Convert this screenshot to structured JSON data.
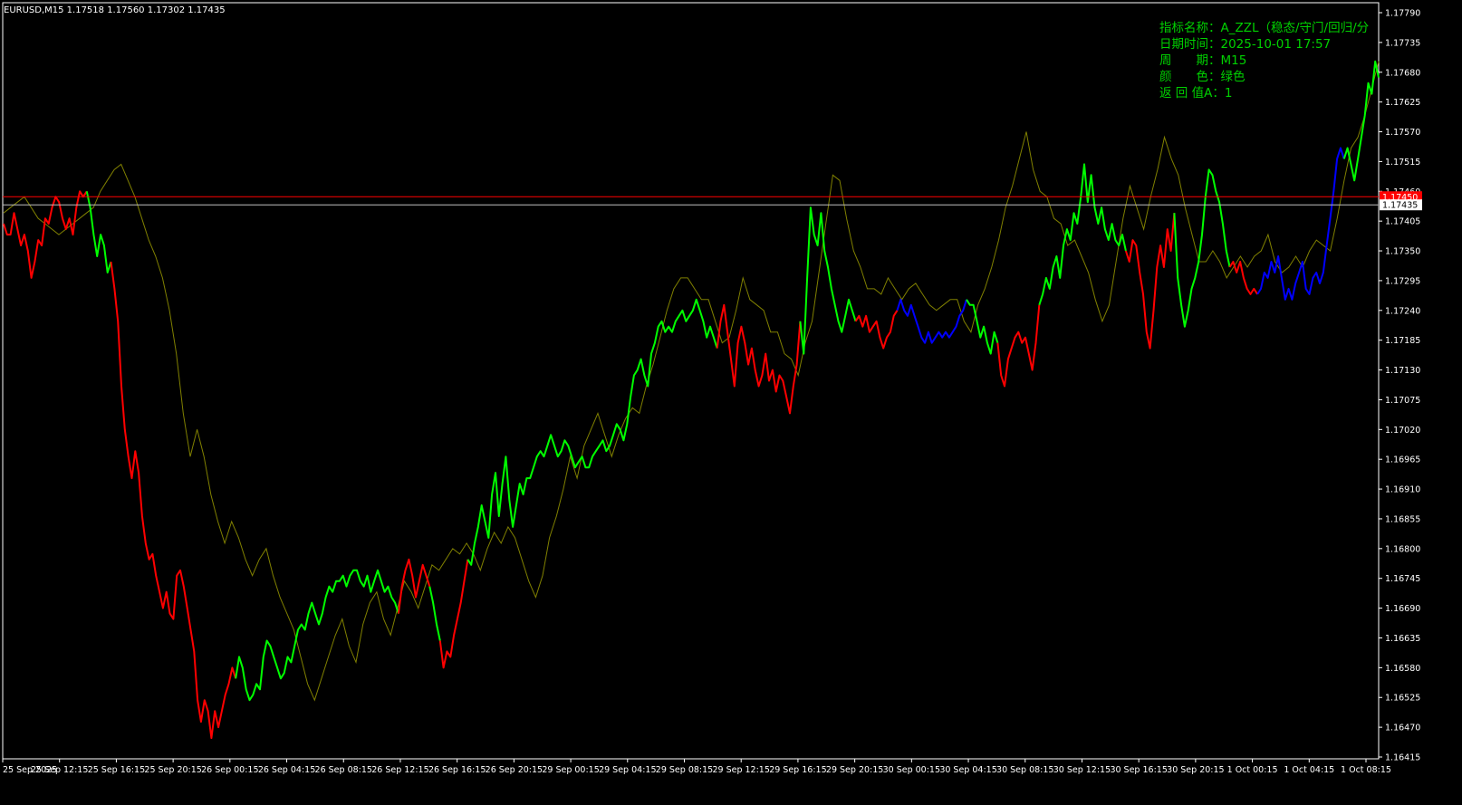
{
  "header": {
    "symbol_line": "EURUSD,M15  1.17518 1.17560 1.17302 1.17435"
  },
  "info_panel": {
    "lines": [
      "指标名称：A_ZZL（稳态/守门/回归/分",
      "日期时间：2025-10-01 17:57",
      "周　　期：M15",
      "颜　　色：绿色",
      "返 回 值A：1"
    ],
    "color": "#00D000"
  },
  "colors": {
    "background": "#000000",
    "axis": "#FFFFFF",
    "green": "#00FF00",
    "red": "#FF0000",
    "blue": "#0000FF",
    "price_line": "#808000",
    "bid_line": "#C0C0C0",
    "ask_line": "#FF0000"
  },
  "price_labels": {
    "bid": "1.17435",
    "ask": "1.17450"
  },
  "chart_data": {
    "type": "line",
    "ylim": [
      1.16415,
      1.1779
    ],
    "yticks": [
      "1.17790",
      "1.17735",
      "1.17680",
      "1.17625",
      "1.17570",
      "1.17515",
      "1.17460",
      "1.17405",
      "1.17350",
      "1.17295",
      "1.17240",
      "1.17185",
      "1.17130",
      "1.17075",
      "1.17020",
      "1.16965",
      "1.16910",
      "1.16855",
      "1.16800",
      "1.16745",
      "1.16690",
      "1.16635",
      "1.16580",
      "1.16525",
      "1.16470",
      "1.16415"
    ],
    "xticks": [
      "25 Sep 2025",
      "25 Sep 12:15",
      "25 Sep 16:15",
      "25 Sep 20:15",
      "26 Sep 00:15",
      "26 Sep 04:15",
      "26 Sep 08:15",
      "26 Sep 12:15",
      "26 Sep 16:15",
      "26 Sep 20:15",
      "29 Sep 00:15",
      "29 Sep 04:15",
      "29 Sep 08:15",
      "29 Sep 12:15",
      "29 Sep 16:15",
      "29 Sep 20:15",
      "30 Sep 00:15",
      "30 Sep 04:15",
      "30 Sep 08:15",
      "30 Sep 12:15",
      "30 Sep 16:15",
      "30 Sep 20:15",
      "1 Oct 00:15",
      "1 Oct 04:15",
      "1 Oct 08:15"
    ],
    "bid_price": 1.17435,
    "ask_price": 1.1745,
    "series": [
      {
        "segments": [
          {
            "color": "red",
            "values": [
              1.174,
              1.1738,
              1.1738,
              1.1742,
              1.1739,
              1.1736,
              1.1738,
              1.1735,
              1.173,
              1.1733,
              1.1737,
              1.1736,
              1.1741,
              1.174,
              1.1743,
              1.1745,
              1.1744,
              1.1741,
              1.1739,
              1.1741,
              1.1738,
              1.1743,
              1.1746,
              1.1745,
              1.1746
            ]
          },
          {
            "color": "green",
            "values": [
              1.1746,
              1.1743,
              1.1738,
              1.1734,
              1.1738,
              1.1736,
              1.1731,
              1.1733
            ]
          },
          {
            "color": "red",
            "values": [
              1.1733,
              1.1728,
              1.1722,
              1.171,
              1.1702,
              1.1697,
              1.1693,
              1.1698,
              1.1694,
              1.1686,
              1.1681,
              1.1678,
              1.1679,
              1.1675,
              1.1672,
              1.1669,
              1.1672,
              1.1668,
              1.1667,
              1.1675,
              1.1676,
              1.1673,
              1.1669,
              1.1665,
              1.1661,
              1.1652,
              1.1648,
              1.1652,
              1.165,
              1.1645,
              1.165,
              1.1647,
              1.165,
              1.1653,
              1.1655,
              1.1658,
              1.1656
            ]
          },
          {
            "color": "green",
            "values": [
              1.1656,
              1.166,
              1.1658,
              1.1654,
              1.1652,
              1.1653,
              1.1655,
              1.1654,
              1.166,
              1.1663,
              1.1662,
              1.166,
              1.1658,
              1.1656,
              1.1657,
              1.166,
              1.1659,
              1.1662,
              1.1665,
              1.1666,
              1.1665,
              1.1668,
              1.167,
              1.1668,
              1.1666,
              1.1668,
              1.1671,
              1.1673,
              1.1672,
              1.1674,
              1.1674,
              1.1675,
              1.1673,
              1.1675,
              1.1676,
              1.1676,
              1.1674,
              1.1673,
              1.1675,
              1.1672,
              1.1674,
              1.1676,
              1.1674,
              1.1672,
              1.1673,
              1.1671,
              1.167,
              1.1668
            ]
          },
          {
            "color": "red",
            "values": [
              1.1668,
              1.1673,
              1.1676,
              1.1678,
              1.1675,
              1.1671,
              1.1674,
              1.1677,
              1.1675,
              1.1673
            ]
          },
          {
            "color": "green",
            "values": [
              1.1673,
              1.167,
              1.1666,
              1.1663
            ]
          },
          {
            "color": "red",
            "values": [
              1.1663,
              1.1658,
              1.1661,
              1.166,
              1.1664,
              1.1667,
              1.167,
              1.1674,
              1.1678
            ]
          },
          {
            "color": "green",
            "values": [
              1.1678,
              1.1677,
              1.1681,
              1.1684,
              1.1688,
              1.1685,
              1.1682,
              1.169,
              1.1694,
              1.1686,
              1.1692,
              1.1697,
              1.1689,
              1.1684,
              1.1688,
              1.1692,
              1.169,
              1.1693,
              1.1693,
              1.1695,
              1.1697,
              1.1698,
              1.1697,
              1.1699,
              1.1701,
              1.1699,
              1.1697,
              1.1698,
              1.17,
              1.1699,
              1.1697,
              1.1695,
              1.1696,
              1.1697,
              1.1695,
              1.1695,
              1.1697,
              1.1698,
              1.1699,
              1.17,
              1.1698,
              1.1699,
              1.1701,
              1.1703,
              1.1702,
              1.17,
              1.1703,
              1.1708,
              1.1712,
              1.1713,
              1.1715,
              1.1712,
              1.171,
              1.1716,
              1.1718,
              1.1721,
              1.1722,
              1.172,
              1.1721,
              1.172,
              1.1722,
              1.1723,
              1.1724,
              1.1722,
              1.1723,
              1.1724,
              1.1726,
              1.1724,
              1.1722,
              1.1719,
              1.1721,
              1.1719,
              1.1717
            ]
          },
          {
            "color": "red",
            "values": [
              1.1717,
              1.1722,
              1.1725,
              1.172,
              1.1715,
              1.171,
              1.1718,
              1.1721,
              1.1718,
              1.1714,
              1.1717,
              1.1713,
              1.171,
              1.1712,
              1.1716,
              1.1711,
              1.1713,
              1.1709,
              1.1712,
              1.1711,
              1.1708,
              1.1705,
              1.171,
              1.1714,
              1.1722
            ]
          },
          {
            "color": "green",
            "values": [
              1.1722,
              1.1716,
              1.173,
              1.1743,
              1.1738,
              1.1736,
              1.1742,
              1.1735,
              1.1732,
              1.1728,
              1.1725,
              1.1722,
              1.172,
              1.1723,
              1.1726,
              1.1724,
              1.1722
            ]
          },
          {
            "color": "red",
            "values": [
              1.1722,
              1.1723,
              1.1721,
              1.1723,
              1.172,
              1.1721,
              1.1722,
              1.1719,
              1.1717,
              1.1719,
              1.172,
              1.1723,
              1.1724
            ]
          },
          {
            "color": "blue",
            "values": [
              1.1724,
              1.1726,
              1.1724,
              1.1723,
              1.1725,
              1.1723,
              1.1721,
              1.1719,
              1.1718,
              1.172,
              1.1718,
              1.1719,
              1.172,
              1.1719,
              1.172,
              1.1719,
              1.172,
              1.1721,
              1.1723,
              1.1724,
              1.1726
            ]
          },
          {
            "color": "green",
            "values": [
              1.1726,
              1.1725,
              1.1725,
              1.1722,
              1.1719,
              1.1721,
              1.1718,
              1.1716,
              1.172,
              1.1718
            ]
          },
          {
            "color": "red",
            "values": [
              1.1718,
              1.1712,
              1.171,
              1.1715,
              1.1717,
              1.1719,
              1.172,
              1.1718,
              1.1719,
              1.1716,
              1.1713,
              1.1718,
              1.1725
            ]
          },
          {
            "color": "green",
            "values": [
              1.1725,
              1.1727,
              1.173,
              1.1728,
              1.1732,
              1.1734,
              1.173,
              1.1736,
              1.1739,
              1.1737,
              1.1742,
              1.174,
              1.1745,
              1.1751,
              1.1744,
              1.1749,
              1.1743,
              1.174,
              1.1743,
              1.1739,
              1.1737,
              1.174,
              1.1737,
              1.1736,
              1.1738,
              1.1735
            ]
          },
          {
            "color": "red",
            "values": [
              1.1735,
              1.1733,
              1.1737,
              1.1736,
              1.1731,
              1.1727,
              1.172,
              1.1717,
              1.1724,
              1.1732,
              1.1736,
              1.1732,
              1.1739,
              1.1735,
              1.1742
            ]
          },
          {
            "color": "green",
            "values": [
              1.1742,
              1.173,
              1.1725,
              1.1721,
              1.1724,
              1.1728,
              1.173,
              1.1733,
              1.1738,
              1.1745,
              1.175,
              1.1749,
              1.1746,
              1.1744,
              1.174,
              1.1735,
              1.1732
            ]
          },
          {
            "color": "red",
            "values": [
              1.1732,
              1.1733,
              1.1731,
              1.1733,
              1.173,
              1.1728,
              1.1727,
              1.1728,
              1.1727
            ]
          },
          {
            "color": "blue",
            "values": [
              1.1727,
              1.1728,
              1.1731,
              1.173,
              1.1733,
              1.1731,
              1.1734,
              1.173,
              1.1726,
              1.1728,
              1.1726,
              1.1729,
              1.1731,
              1.1733,
              1.1728,
              1.1727,
              1.173,
              1.1731,
              1.1729,
              1.1731,
              1.1736,
              1.1741,
              1.1746,
              1.1752,
              1.1754,
              1.1752
            ]
          },
          {
            "color": "green",
            "values": [
              1.1752,
              1.1754,
              1.1751,
              1.1748,
              1.1752,
              1.1756,
              1.176,
              1.1766,
              1.1764,
              1.177,
              1.1767
            ]
          }
        ]
      },
      {
        "color": "price_line",
        "values": [
          1.1742,
          1.1743,
          1.1744,
          1.1745,
          1.1743,
          1.1741,
          1.174,
          1.1739,
          1.1738,
          1.1739,
          1.174,
          1.1741,
          1.1742,
          1.1743,
          1.1746,
          1.1748,
          1.175,
          1.1751,
          1.1748,
          1.1745,
          1.1741,
          1.1737,
          1.1734,
          1.173,
          1.1724,
          1.1716,
          1.1705,
          1.1697,
          1.1702,
          1.1697,
          1.169,
          1.1685,
          1.1681,
          1.1685,
          1.1682,
          1.1678,
          1.1675,
          1.1678,
          1.168,
          1.1675,
          1.1671,
          1.1668,
          1.1665,
          1.166,
          1.1655,
          1.1652,
          1.1656,
          1.166,
          1.1664,
          1.1667,
          1.1662,
          1.1659,
          1.1666,
          1.167,
          1.1672,
          1.1667,
          1.1664,
          1.1669,
          1.1674,
          1.1672,
          1.1669,
          1.1673,
          1.1677,
          1.1676,
          1.1678,
          1.168,
          1.1679,
          1.1681,
          1.1679,
          1.1676,
          1.168,
          1.1683,
          1.1681,
          1.1684,
          1.1682,
          1.1678,
          1.1674,
          1.1671,
          1.1675,
          1.1682,
          1.1686,
          1.1691,
          1.1697,
          1.1693,
          1.1699,
          1.1702,
          1.1705,
          1.1701,
          1.1697,
          1.1701,
          1.1704,
          1.1706,
          1.1705,
          1.171,
          1.1714,
          1.1719,
          1.1724,
          1.1728,
          1.173,
          1.173,
          1.1728,
          1.1726,
          1.1726,
          1.1722,
          1.1718,
          1.1719,
          1.1724,
          1.173,
          1.1726,
          1.1725,
          1.1724,
          1.172,
          1.172,
          1.1716,
          1.1715,
          1.1712,
          1.1718,
          1.1722,
          1.1731,
          1.174,
          1.1749,
          1.1748,
          1.1741,
          1.1735,
          1.1732,
          1.1728,
          1.1728,
          1.1727,
          1.173,
          1.1728,
          1.1726,
          1.1728,
          1.1729,
          1.1727,
          1.1725,
          1.1724,
          1.1725,
          1.1726,
          1.1726,
          1.1722,
          1.172,
          1.1725,
          1.1728,
          1.1732,
          1.1737,
          1.1743,
          1.1747,
          1.1752,
          1.1757,
          1.175,
          1.1746,
          1.1745,
          1.1741,
          1.174,
          1.1736,
          1.1737,
          1.1734,
          1.1731,
          1.1726,
          1.1722,
          1.1725,
          1.1733,
          1.1741,
          1.1747,
          1.1743,
          1.1739,
          1.1745,
          1.175,
          1.1756,
          1.1752,
          1.1749,
          1.1743,
          1.1738,
          1.1733,
          1.1733,
          1.1735,
          1.1733,
          1.173,
          1.1732,
          1.1734,
          1.1732,
          1.1734,
          1.1735,
          1.1738,
          1.1733,
          1.1731,
          1.1732,
          1.1734,
          1.1732,
          1.1735,
          1.1737,
          1.1736,
          1.1735,
          1.1741,
          1.1748,
          1.1754,
          1.1756,
          1.176,
          1.1765,
          1.177
        ]
      }
    ]
  }
}
